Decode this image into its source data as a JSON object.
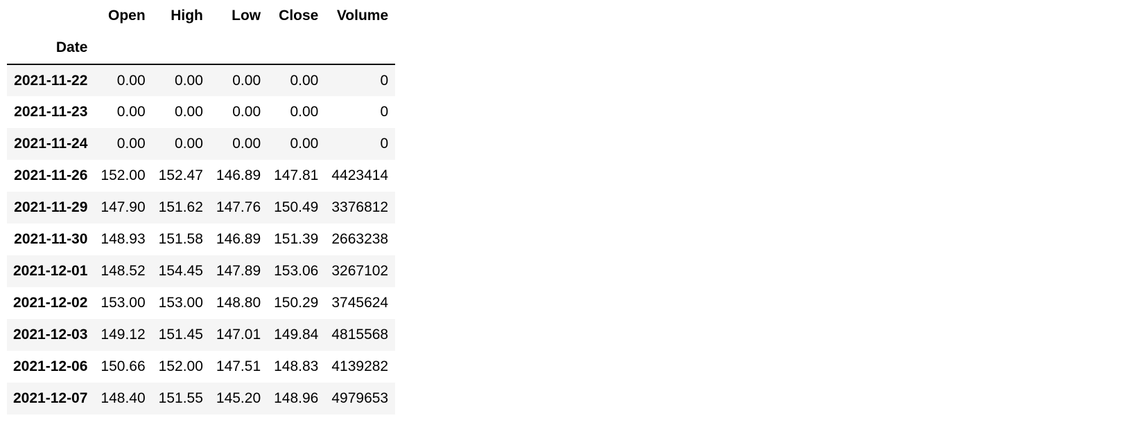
{
  "table": {
    "columns": [
      "Open",
      "High",
      "Low",
      "Close",
      "Volume"
    ],
    "index_name": "Date",
    "rows": [
      {
        "date": "2021-11-22",
        "values": [
          "0.00",
          "0.00",
          "0.00",
          "0.00",
          "0"
        ]
      },
      {
        "date": "2021-11-23",
        "values": [
          "0.00",
          "0.00",
          "0.00",
          "0.00",
          "0"
        ]
      },
      {
        "date": "2021-11-24",
        "values": [
          "0.00",
          "0.00",
          "0.00",
          "0.00",
          "0"
        ]
      },
      {
        "date": "2021-11-26",
        "values": [
          "152.00",
          "152.47",
          "146.89",
          "147.81",
          "4423414"
        ]
      },
      {
        "date": "2021-11-29",
        "values": [
          "147.90",
          "151.62",
          "147.76",
          "150.49",
          "3376812"
        ]
      },
      {
        "date": "2021-11-30",
        "values": [
          "148.93",
          "151.58",
          "146.89",
          "151.39",
          "2663238"
        ]
      },
      {
        "date": "2021-12-01",
        "values": [
          "148.52",
          "154.45",
          "147.89",
          "153.06",
          "3267102"
        ]
      },
      {
        "date": "2021-12-02",
        "values": [
          "153.00",
          "153.00",
          "148.80",
          "150.29",
          "3745624"
        ]
      },
      {
        "date": "2021-12-03",
        "values": [
          "149.12",
          "151.45",
          "147.01",
          "149.84",
          "4815568"
        ]
      },
      {
        "date": "2021-12-06",
        "values": [
          "150.66",
          "152.00",
          "147.51",
          "148.83",
          "4139282"
        ]
      },
      {
        "date": "2021-12-07",
        "values": [
          "148.40",
          "151.55",
          "145.20",
          "148.96",
          "4979653"
        ]
      }
    ]
  }
}
